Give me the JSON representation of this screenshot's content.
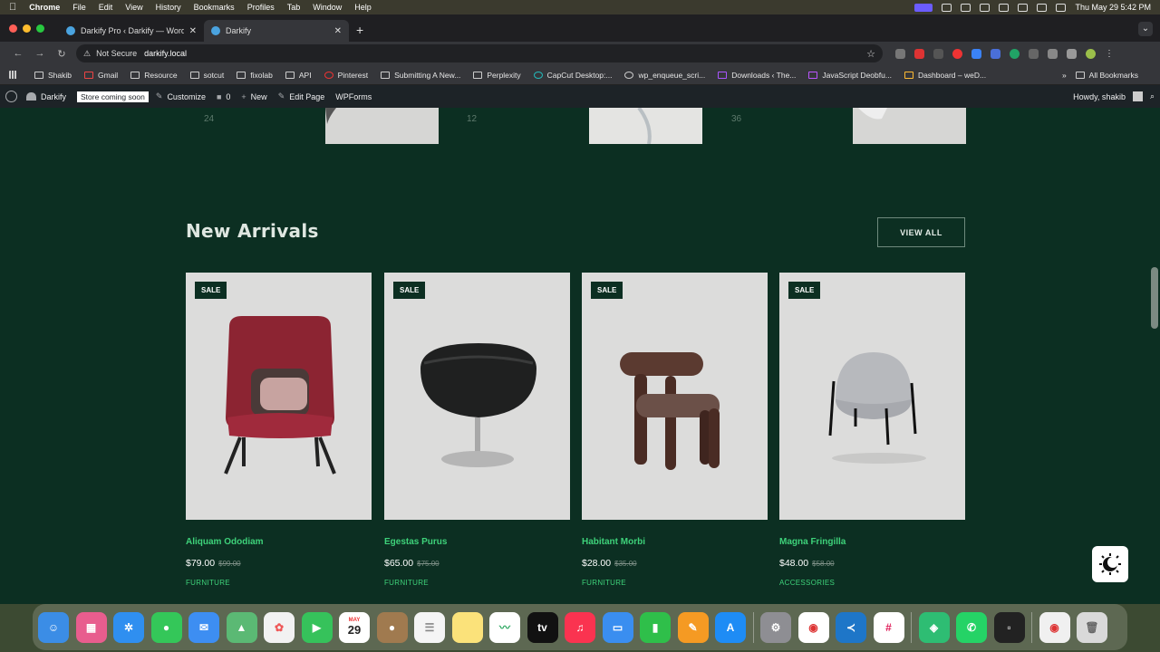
{
  "menubar": {
    "app": "Chrome",
    "items": [
      "File",
      "Edit",
      "View",
      "History",
      "Bookmarks",
      "Profiles",
      "Tab",
      "Window",
      "Help"
    ],
    "datetime": "Thu May 29  5:42 PM"
  },
  "tabs": [
    {
      "label": "Darkify Pro ‹ Darkify — WordPress"
    },
    {
      "label": "Darkify"
    }
  ],
  "address": {
    "security": "Not Secure",
    "url": "darkify.local"
  },
  "bookmarks": [
    "Shakib",
    "Gmail",
    "Resource",
    "sotcut",
    "fixolab",
    "API",
    "Pinterest",
    "Submitting A New...",
    "Perplexity",
    "CapCut Desktop:...",
    "wp_enqueue_scri...",
    "Downloads ‹ The...",
    "JavaScript Deobfu...",
    "Dashboard – weD..."
  ],
  "bookmarks_all": "All Bookmarks",
  "wpbar": {
    "site": "Darkify",
    "badge": "Store coming soon",
    "customize": "Customize",
    "comments": "0",
    "new": "New",
    "edit": "Edit Page",
    "wpforms": "WPForms",
    "howdy": "Howdy, shakib"
  },
  "categories_strip": [
    "24",
    "12",
    "36"
  ],
  "section": {
    "title": "New Arrivals",
    "view_all": "VIEW ALL"
  },
  "products": [
    {
      "badge": "SALE",
      "name": "Aliquam Ododiam",
      "price": "$79.00",
      "old_price": "$99.00",
      "category": "FURNITURE",
      "image": "red-lounge-chair"
    },
    {
      "badge": "SALE",
      "name": "Egestas Purus",
      "price": "$65.00",
      "old_price": "$75.00",
      "category": "FURNITURE",
      "image": "black-egg-chair"
    },
    {
      "badge": "SALE",
      "name": "Habitant Morbi",
      "price": "$28.00",
      "old_price": "$35.00",
      "category": "FURNITURE",
      "image": "brown-dining-chair"
    },
    {
      "badge": "SALE",
      "name": "Magna Fringilla",
      "price": "$48.00",
      "old_price": "$58.00",
      "category": "ACCESSORIES",
      "image": "grey-pouf-stool"
    }
  ],
  "dock": {
    "calendar_month": "MAY",
    "calendar_day": "29"
  },
  "colors": {
    "page_bg": "#0c2f22",
    "accent": "#3ed27a",
    "card_bg": "#dcdcdb"
  }
}
